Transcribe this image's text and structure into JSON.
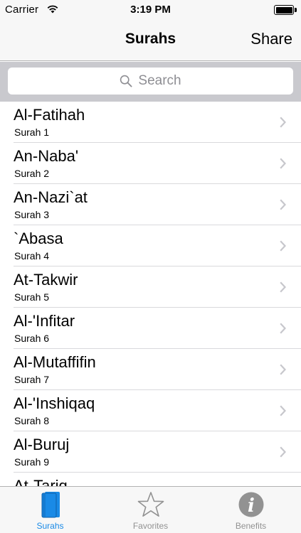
{
  "status_bar": {
    "carrier": "Carrier",
    "time": "3:19 PM"
  },
  "nav": {
    "title": "Surahs",
    "right_button": "Share"
  },
  "search": {
    "placeholder": "Search"
  },
  "list": {
    "items": [
      {
        "title": "Al-Fatihah",
        "subtitle": "Surah 1"
      },
      {
        "title": "An-Naba'",
        "subtitle": "Surah 2"
      },
      {
        "title": "An-Nazi`at",
        "subtitle": "Surah 3"
      },
      {
        "title": "`Abasa",
        "subtitle": "Surah 4"
      },
      {
        "title": "At-Takwir",
        "subtitle": "Surah 5"
      },
      {
        "title": "Al-'Infitar",
        "subtitle": "Surah 6"
      },
      {
        "title": "Al-Mutaffifin",
        "subtitle": "Surah 7"
      },
      {
        "title": "Al-'Inshiqaq",
        "subtitle": "Surah 8"
      },
      {
        "title": "Al-Buruj",
        "subtitle": "Surah 9"
      },
      {
        "title": "At-Tariq",
        "subtitle": ""
      }
    ]
  },
  "tabbar": {
    "tabs": [
      {
        "label": "Surahs",
        "icon": "book-icon",
        "selected": true
      },
      {
        "label": "Favorites",
        "icon": "star-icon",
        "selected": false
      },
      {
        "label": "Benefits",
        "icon": "info-icon",
        "selected": false
      }
    ]
  },
  "colors": {
    "accent": "#1a8ae6",
    "inactive_tab": "#929292",
    "bar_background": "#f7f7f7",
    "search_background": "#c9c9ce",
    "chevron": "#c7c7cc"
  }
}
